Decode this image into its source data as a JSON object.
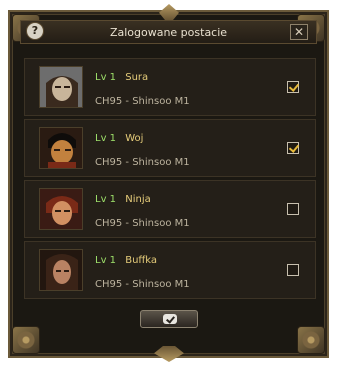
{
  "window": {
    "title": "Zalogowane postacie",
    "help_icon": "?",
    "close_icon": "close-icon"
  },
  "characters": [
    {
      "level": "Lv 1",
      "name": "Sura",
      "server": "CH95 - Shinsoo M1",
      "selected": true,
      "avatar_icon": "sura-portrait",
      "avatar_colors": [
        "#6d6d6d",
        "#c8b59a",
        "#3a2a1e"
      ]
    },
    {
      "level": "Lv 1",
      "name": "Woj",
      "server": "CH95 - Shinsoo M1",
      "selected": true,
      "avatar_icon": "warrior-portrait",
      "avatar_colors": [
        "#2a1b12",
        "#c2813e",
        "#7a2a17"
      ]
    },
    {
      "level": "Lv 1",
      "name": "Ninja",
      "server": "CH95 - Shinsoo M1",
      "selected": false,
      "avatar_icon": "ninja-portrait",
      "avatar_colors": [
        "#7a2a17",
        "#d29062",
        "#3a1b14"
      ]
    },
    {
      "level": "Lv 1",
      "name": "Buffka",
      "server": "CH95 - Shinsoo M1",
      "selected": false,
      "avatar_icon": "shaman-portrait",
      "avatar_colors": [
        "#3a2317",
        "#b98263",
        "#22160f"
      ]
    }
  ],
  "confirm_button": {
    "icon": "checkmark-icon"
  },
  "colors": {
    "level": "#9ee06a",
    "name": "#e5cc7a",
    "server": "#bcb39e",
    "title": "#e8e0cf"
  }
}
